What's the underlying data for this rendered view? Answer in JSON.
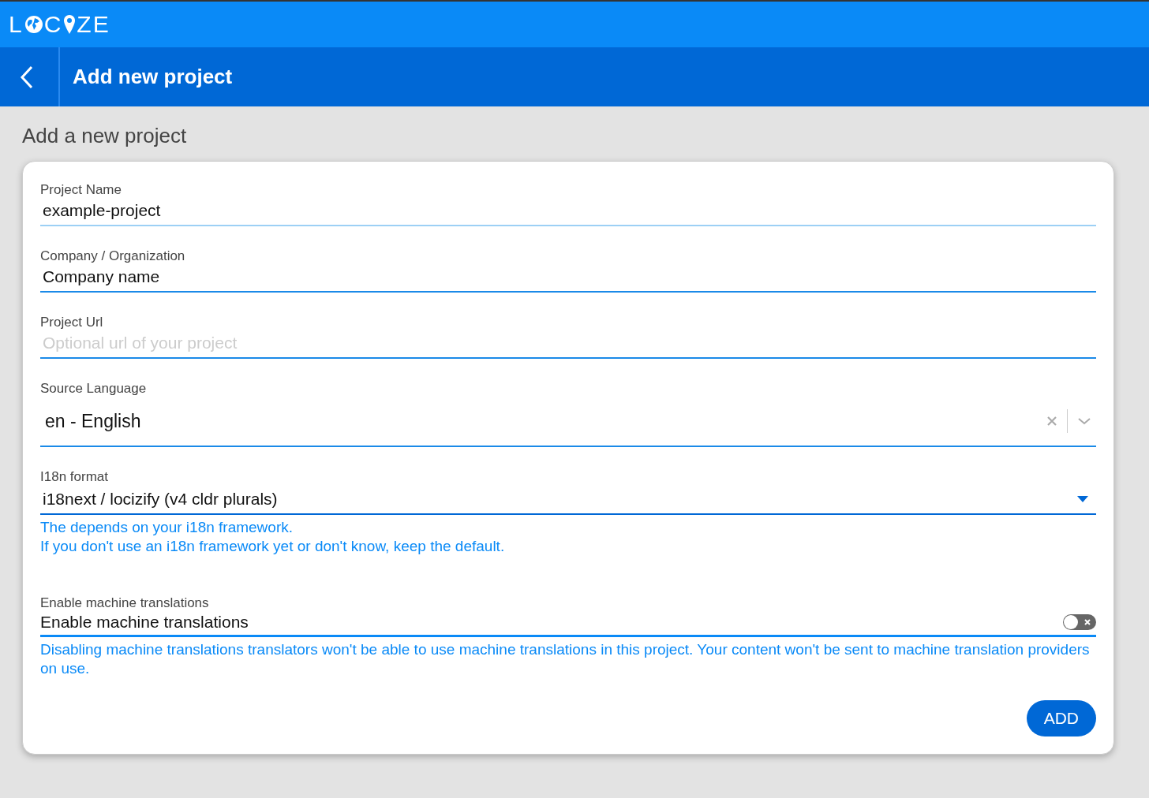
{
  "logo": {
    "parts": [
      {
        "kind": "text",
        "text": "L"
      },
      {
        "kind": "globe"
      },
      {
        "kind": "text",
        "text": "C"
      },
      {
        "kind": "pin"
      },
      {
        "kind": "text",
        "text": "ZE"
      }
    ]
  },
  "header": {
    "title": "Add new project"
  },
  "page_title": "Add a new project",
  "fields": [
    {
      "kind": "text",
      "label": "Project Name",
      "value": "example-project"
    },
    {
      "kind": "text",
      "label": "Company / Organization",
      "value": "Company name"
    },
    {
      "kind": "text",
      "label": "Project Url",
      "placeholder": "Optional url of your project"
    },
    {
      "kind": "select",
      "label": "Source Language",
      "value": "en - English"
    },
    {
      "kind": "dropdown",
      "label": "I18n format",
      "value": "i18next / locizify (v4 cldr plurals)",
      "help": [
        "The depends on your i18n framework.",
        "If you don't use an i18n framework yet or don't know, keep the default."
      ]
    },
    {
      "kind": "toggle",
      "label": "Enable machine translations",
      "value": "Enable machine translations",
      "on": false,
      "help": [
        "Disabling machine translations translators won't be able to use machine translations in this project. Your content won't be sent to machine translation providers on use."
      ]
    }
  ],
  "submit": "ADD"
}
